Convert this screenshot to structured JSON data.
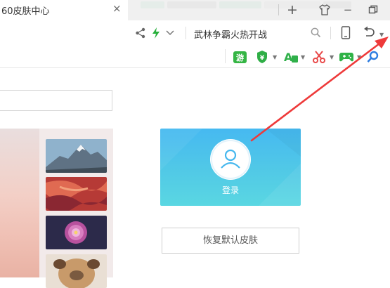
{
  "tab": {
    "title": "60皮肤中心",
    "close": "×"
  },
  "window": {
    "new_tab": "+",
    "minimize": "−"
  },
  "search": {
    "text": "武林争霸火热开战"
  },
  "skin_center": {
    "login_label": "登录",
    "restore_label": "恢复默认皮肤"
  },
  "colors": {
    "login_gradient_top": "#46b9f1",
    "login_gradient_bottom": "#5ad7e2",
    "arrow": "#ee3a3a",
    "ext_green": "#34b544"
  }
}
